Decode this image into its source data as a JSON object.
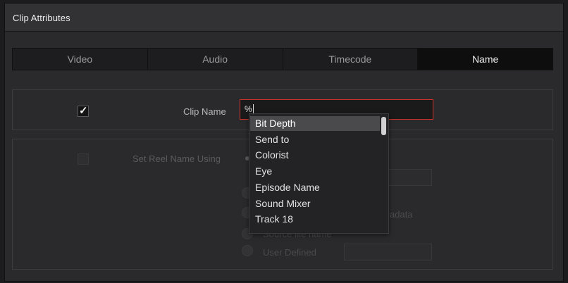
{
  "window": {
    "title": "Clip Attributes"
  },
  "tabs": [
    {
      "label": "Video",
      "active": false
    },
    {
      "label": "Audio",
      "active": false
    },
    {
      "label": "Timecode",
      "active": false
    },
    {
      "label": "Name",
      "active": true
    }
  ],
  "clip_name": {
    "checked": true,
    "checkmark": "✓",
    "label": "Clip Name",
    "value": "%",
    "border_color": "#d0312a"
  },
  "reel": {
    "label": "Set Reel Name Using",
    "options": [
      {
        "label": "adata"
      },
      {
        "label": "Source file name"
      },
      {
        "label": "User Defined"
      }
    ]
  },
  "dropdown": {
    "items": [
      "Bit Depth",
      "Send to",
      "Colorist",
      "Eye",
      "Episode Name",
      "Sound Mixer",
      "Track 18"
    ],
    "selected_index": 0
  },
  "colors": {
    "accent_red": "#d0312a",
    "active_tab_bg": "#0e0e0f",
    "selected_item_bg": "#4a4a4d"
  }
}
